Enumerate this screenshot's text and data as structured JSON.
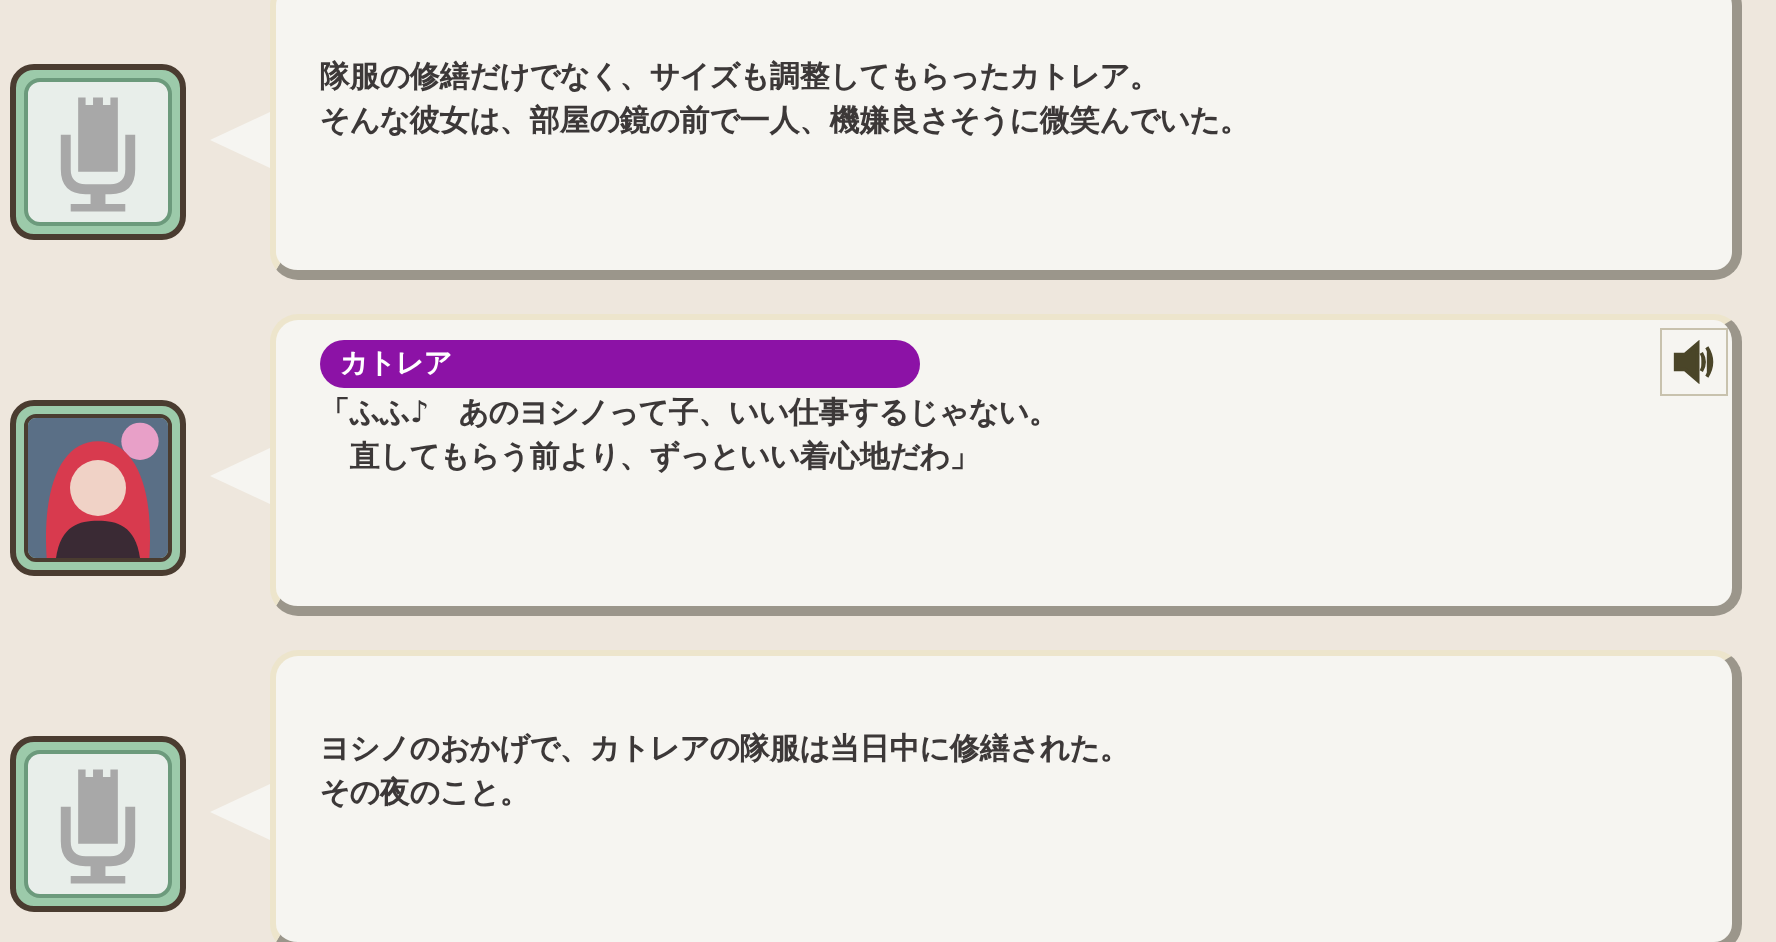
{
  "log": [
    {
      "kind": "narration",
      "lines": [
        "隊服の修繕だけでなく、サイズも調整してもらったカトレア。",
        "そんな彼女は、部屋の鏡の前で一人、機嫌良さそうに微笑んでいた。"
      ],
      "voice": false
    },
    {
      "kind": "character",
      "speaker": "カトレア",
      "lines": [
        "「ふふ♪　あのヨシノって子、いい仕事するじゃない。",
        "　直してもらう前より、ずっといい着心地だわ」"
      ],
      "voice": true
    },
    {
      "kind": "narration",
      "lines": [
        "ヨシノのおかげで、カトレアの隊服は当日中に修繕された。",
        "その夜のこと。"
      ],
      "voice": false
    }
  ]
}
